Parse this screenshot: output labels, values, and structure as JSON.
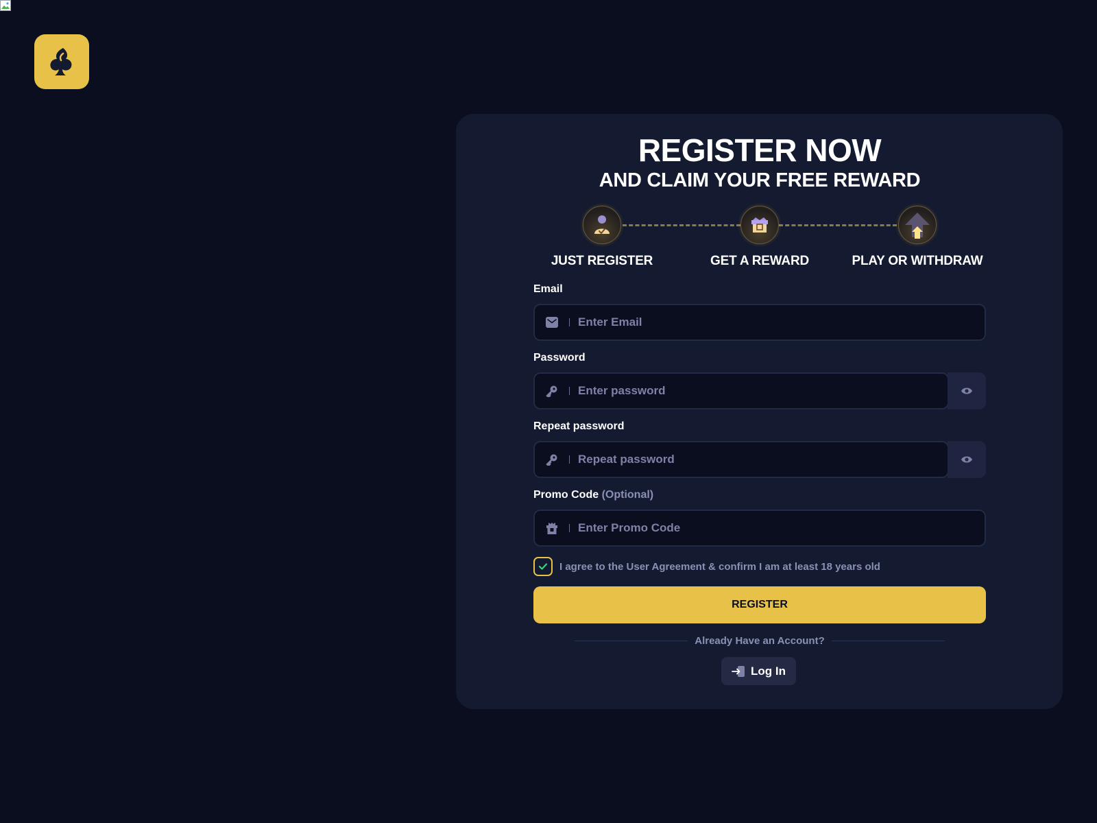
{
  "header": {
    "logo": "spade-logo"
  },
  "register": {
    "title": "REGISTER NOW",
    "subtitle": "AND CLAIM YOUR FREE REWARD",
    "steps": [
      {
        "label": "JUST REGISTER",
        "icon": "user-check-icon"
      },
      {
        "label": "GET A REWARD",
        "icon": "gift-icon"
      },
      {
        "label": "PLAY OR WITHDRAW",
        "icon": "arrow-up-icon"
      }
    ],
    "email": {
      "label": "Email",
      "placeholder": "Enter Email",
      "icon": "mail-icon"
    },
    "password": {
      "label": "Password",
      "placeholder": "Enter password",
      "icon": "key-icon"
    },
    "repeat_password": {
      "label": "Repeat password",
      "placeholder": "Repeat password",
      "icon": "key-icon"
    },
    "promo": {
      "label": "Promo Code",
      "optional": "(Optional)",
      "placeholder": "Enter Promo Code",
      "icon": "gift-icon"
    },
    "agree": {
      "text": "I agree to the User Agreement & confirm I am at least 18 years old",
      "checked": true
    },
    "register_button": "REGISTER",
    "already_account": "Already Have an Account?",
    "login_button": "Log In"
  },
  "colors": {
    "background": "#0b0e1e",
    "card": "#141a2f",
    "accent": "#e8c248",
    "muted_text": "#8b90b5",
    "check_green": "#3ad47a"
  }
}
